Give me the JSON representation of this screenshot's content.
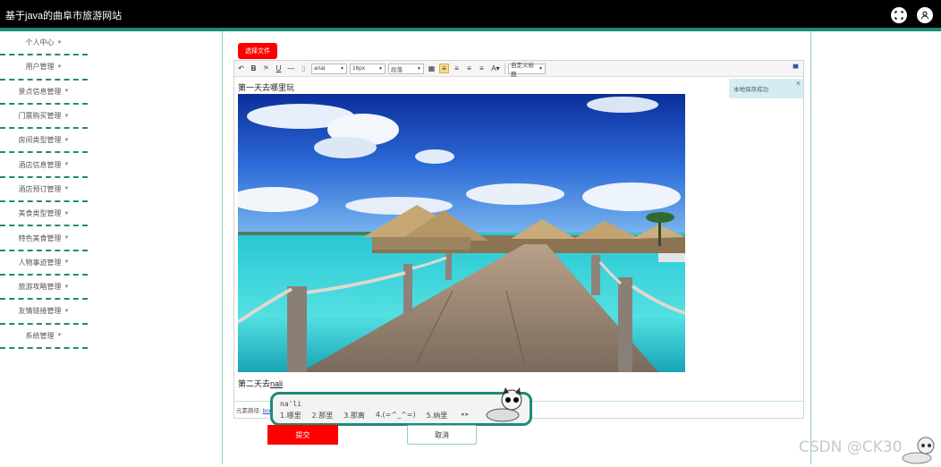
{
  "header": {
    "title": "基于java的曲阜市旅游网站"
  },
  "sidebar": {
    "items": [
      {
        "label": "个人中心"
      },
      {
        "label": "用户管理"
      },
      {
        "label": "景点信息管理"
      },
      {
        "label": "门票购买管理"
      },
      {
        "label": "房间类型管理"
      },
      {
        "label": "酒店信息管理"
      },
      {
        "label": "酒店预订管理"
      },
      {
        "label": "美食类型管理"
      },
      {
        "label": "特色美食管理"
      },
      {
        "label": "人物事迹管理"
      },
      {
        "label": "旅游攻略管理"
      },
      {
        "label": "友情链接管理"
      },
      {
        "label": "系统管理"
      }
    ]
  },
  "upload": {
    "label": "选择文件"
  },
  "toolbar": {
    "font_family": "arial",
    "font_size": "16px",
    "paragraph": "段落",
    "custom_title": "自定义标题"
  },
  "editor": {
    "line1": "第一天去哪里玩",
    "line2_prefix": "第二天去",
    "line2_underlined": "nali",
    "notice": "本地保存成功",
    "notice_close": "×",
    "status_prefix": "元素路径:",
    "status_link": "body"
  },
  "ime": {
    "pinyin": "na'li",
    "candidates": [
      "1.哪里",
      "2.那里",
      "3.那离",
      "4.(=^_^=)",
      "5.纳里"
    ]
  },
  "actions": {
    "submit": "提交",
    "cancel": "取消"
  },
  "watermark": "CSDN @CK30"
}
